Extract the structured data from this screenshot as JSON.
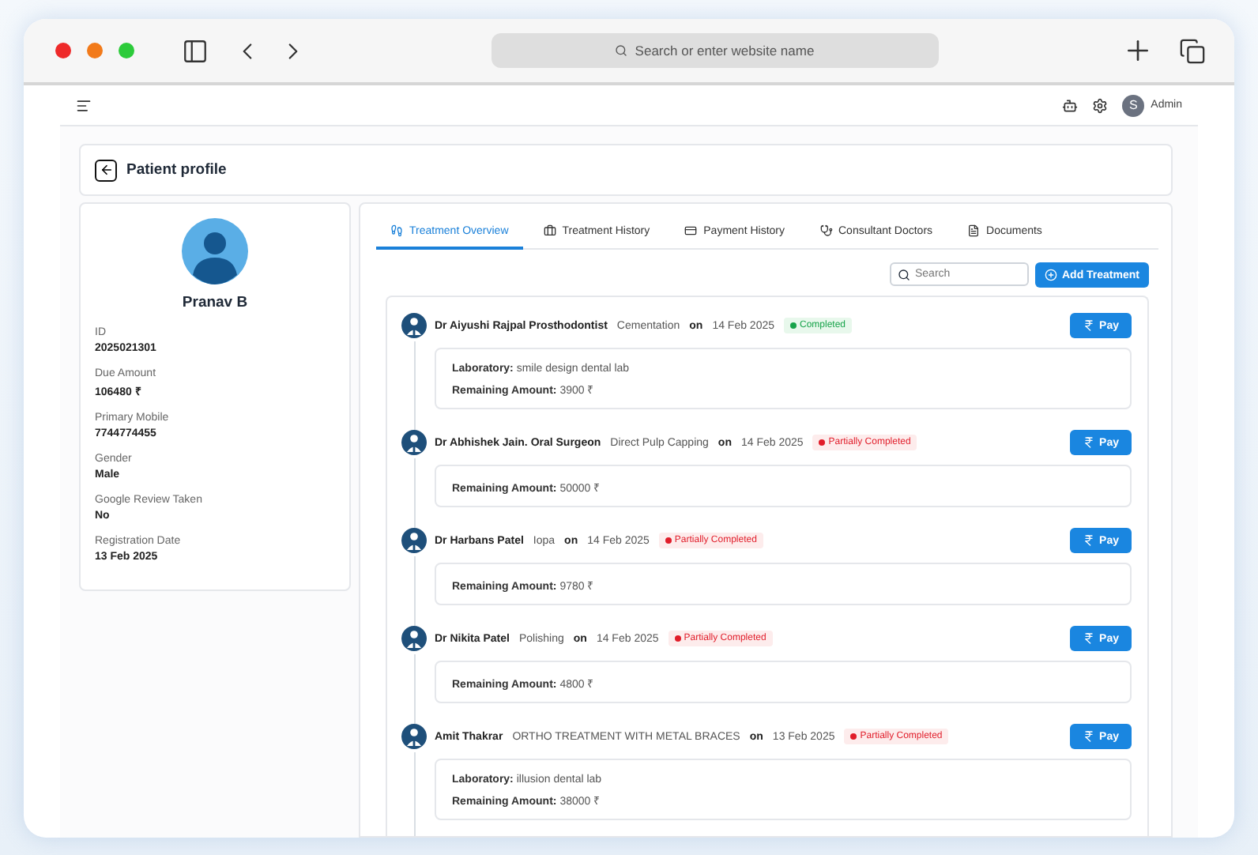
{
  "browser": {
    "address_placeholder": "Search or enter website name"
  },
  "header": {
    "avatar_initial": "S",
    "user": "Admin"
  },
  "page_title": "Patient profile",
  "patient": {
    "name": "Pranav B",
    "fields": [
      {
        "label": "ID",
        "value": "2025021301"
      },
      {
        "label": "Due Amount",
        "value": "106480 ₹"
      },
      {
        "label": "Primary Mobile",
        "value": "7744774455"
      },
      {
        "label": "Gender",
        "value": "Male"
      },
      {
        "label": "Google Review Taken",
        "value": "No"
      },
      {
        "label": "Registration Date",
        "value": "13 Feb 2025"
      }
    ]
  },
  "tabs": [
    {
      "label": "Treatment Overview",
      "selected": true
    },
    {
      "label": "Treatment History",
      "selected": false
    },
    {
      "label": "Payment History",
      "selected": false
    },
    {
      "label": "Consultant Doctors",
      "selected": false
    },
    {
      "label": "Documents",
      "selected": false
    }
  ],
  "search": {
    "placeholder": "Search"
  },
  "add_button": "Add Treatment",
  "treatments": [
    {
      "doctor": "Dr Aiyushi Rajpal Prosthodontist",
      "procedure": "Cementation",
      "on": "on",
      "date": "14 Feb 2025",
      "status": {
        "kind": "completed",
        "label": "Completed"
      },
      "pay": "Pay",
      "details": [
        "**Laboratory:** smile design dental lab",
        "**Remaining Amount:** 3900 ₹"
      ]
    },
    {
      "doctor": "Dr Abhishek Jain. Oral Surgeon",
      "procedure": "Direct Pulp Capping",
      "on": "on",
      "date": "14 Feb 2025",
      "status": {
        "kind": "partial",
        "label": "Partially Completed"
      },
      "pay": "Pay",
      "details": [
        "**Remaining Amount:** 50000 ₹"
      ]
    },
    {
      "doctor": "Dr Harbans Patel",
      "procedure": "Iopa",
      "on": "on",
      "date": "14 Feb 2025",
      "status": {
        "kind": "partial",
        "label": "Partially Completed"
      },
      "pay": "Pay",
      "details": [
        "**Remaining Amount:** 9780 ₹"
      ]
    },
    {
      "doctor": "Dr Nikita Patel",
      "procedure": "Polishing",
      "on": "on",
      "date": "14 Feb 2025",
      "status": {
        "kind": "partial",
        "label": "Partially Completed"
      },
      "pay": "Pay",
      "details": [
        "**Remaining Amount:** 4800 ₹"
      ]
    },
    {
      "doctor": "Amit Thakrar",
      "procedure": "ORTHO TREATMENT WITH METAL BRACES",
      "on": "on",
      "date": "13 Feb 2025",
      "status": {
        "kind": "partial",
        "label": "Partially Completed"
      },
      "pay": "Pay",
      "details": [
        "**Laboratory:** illusion dental lab",
        "**Remaining Amount:** 38000 ₹"
      ]
    }
  ]
}
